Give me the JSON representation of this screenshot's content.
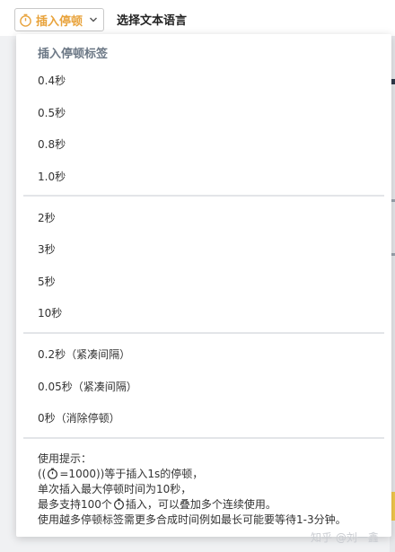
{
  "toolbar": {
    "pause_button_label": "插入停顿",
    "language_button_label": "选择文本语言"
  },
  "dropdown": {
    "title": "插入停顿标签",
    "group1": [
      "0.4秒",
      "0.5秒",
      "0.8秒",
      "1.0秒"
    ],
    "group2": [
      "2秒",
      "3秒",
      "5秒",
      "10秒"
    ],
    "group3": [
      "0.2秒（紧凑间隔）",
      "0.05秒（紧凑间隔）",
      "0秒（消除停顿）"
    ],
    "tips": {
      "line1": "使用提示：",
      "line2_pre": "((",
      "line2_post": "=1000))等于插入1s的停顿，",
      "line3": "单次插入最大停顿时间为10秒，",
      "line4_pre": "最多支持100个",
      "line4_post": "插入，可以叠加多个连续使用。",
      "line5": "使用越多停顿标签需更多合成时间例如最长可能要等待1-3分钟。"
    }
  },
  "watermark": "知乎 @刘一鑫",
  "colors": {
    "accent": "#e8a33c",
    "title_gray": "#6b7785",
    "divider": "#e3e5e8"
  }
}
